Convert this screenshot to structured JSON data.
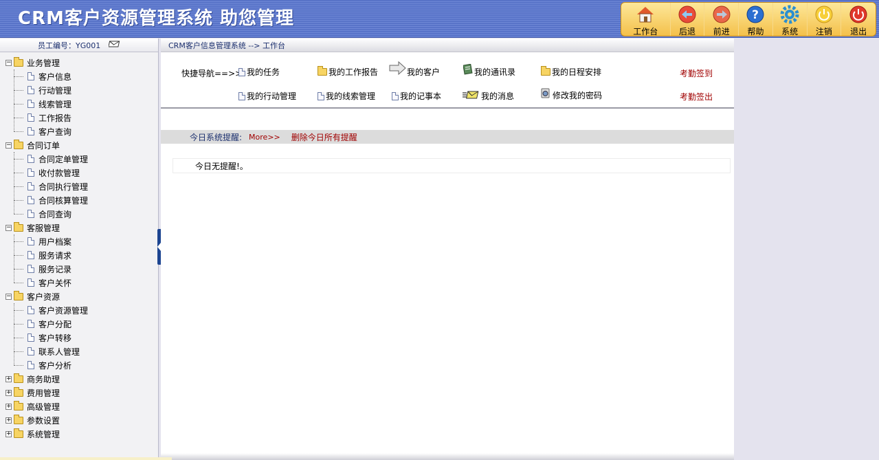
{
  "header": {
    "title": "CRM客户资源管理系统  助您管理"
  },
  "toolbar": [
    {
      "label": "工作台",
      "icon": "home-icon",
      "color": "#e05a2b"
    },
    {
      "label": "后退",
      "icon": "back-arrow-icon",
      "color": "#3a7bd5"
    },
    {
      "label": "前进",
      "icon": "forward-arrow-icon",
      "color": "#3a7bd5"
    },
    {
      "label": "帮助",
      "icon": "help-icon",
      "color": "#2b6fd1"
    },
    {
      "label": "系统",
      "icon": "gear-icon",
      "color": "#2b8fd1"
    },
    {
      "label": "注销",
      "icon": "logout-icon",
      "color": "#f5c22a"
    },
    {
      "label": "退出",
      "icon": "power-icon",
      "color": "#e03a2b"
    }
  ],
  "sidebar": {
    "employee": "员工编号：YG001",
    "groups": [
      {
        "label": "业务管理",
        "expanded": true,
        "items": [
          "客户信息",
          "行动管理",
          "线索管理",
          "工作报告",
          "客户查询"
        ]
      },
      {
        "label": "合同订单",
        "expanded": true,
        "items": [
          "合同定单管理",
          "收付款管理",
          "合同执行管理",
          "合同核算管理",
          "合同查询"
        ]
      },
      {
        "label": "客服管理",
        "expanded": true,
        "items": [
          "用户档案",
          "服务请求",
          "服务记录",
          "客户关怀"
        ]
      },
      {
        "label": "客户资源",
        "expanded": true,
        "items": [
          "客户资源管理",
          "客户分配",
          "客户转移",
          "联系人管理",
          "客户分析"
        ]
      },
      {
        "label": "商务助理",
        "expanded": false,
        "items": []
      },
      {
        "label": "费用管理",
        "expanded": false,
        "items": []
      },
      {
        "label": "高级管理",
        "expanded": false,
        "items": []
      },
      {
        "label": "参数设置",
        "expanded": false,
        "items": []
      },
      {
        "label": "系统管理",
        "expanded": false,
        "items": []
      }
    ]
  },
  "main": {
    "breadcrumb": "CRM客户信息管理系统 --> 工作台",
    "quicknav": {
      "title": "快捷导航==>>",
      "row1": [
        "我的任务",
        "我的工作报告",
        "我的客户",
        "我的通讯录",
        "我的日程安排"
      ],
      "row2": [
        "我的行动管理",
        "我的线索管理",
        "我的记事本",
        "我的消息",
        "修改我的密码"
      ],
      "checkin": "考勤签到",
      "checkout": "考勤签出"
    },
    "reminder": {
      "title": "今日系统提醒:",
      "more": "More>>",
      "delete_all": "删除今日所有提醒",
      "empty_text": "今日无提醒!。"
    }
  }
}
